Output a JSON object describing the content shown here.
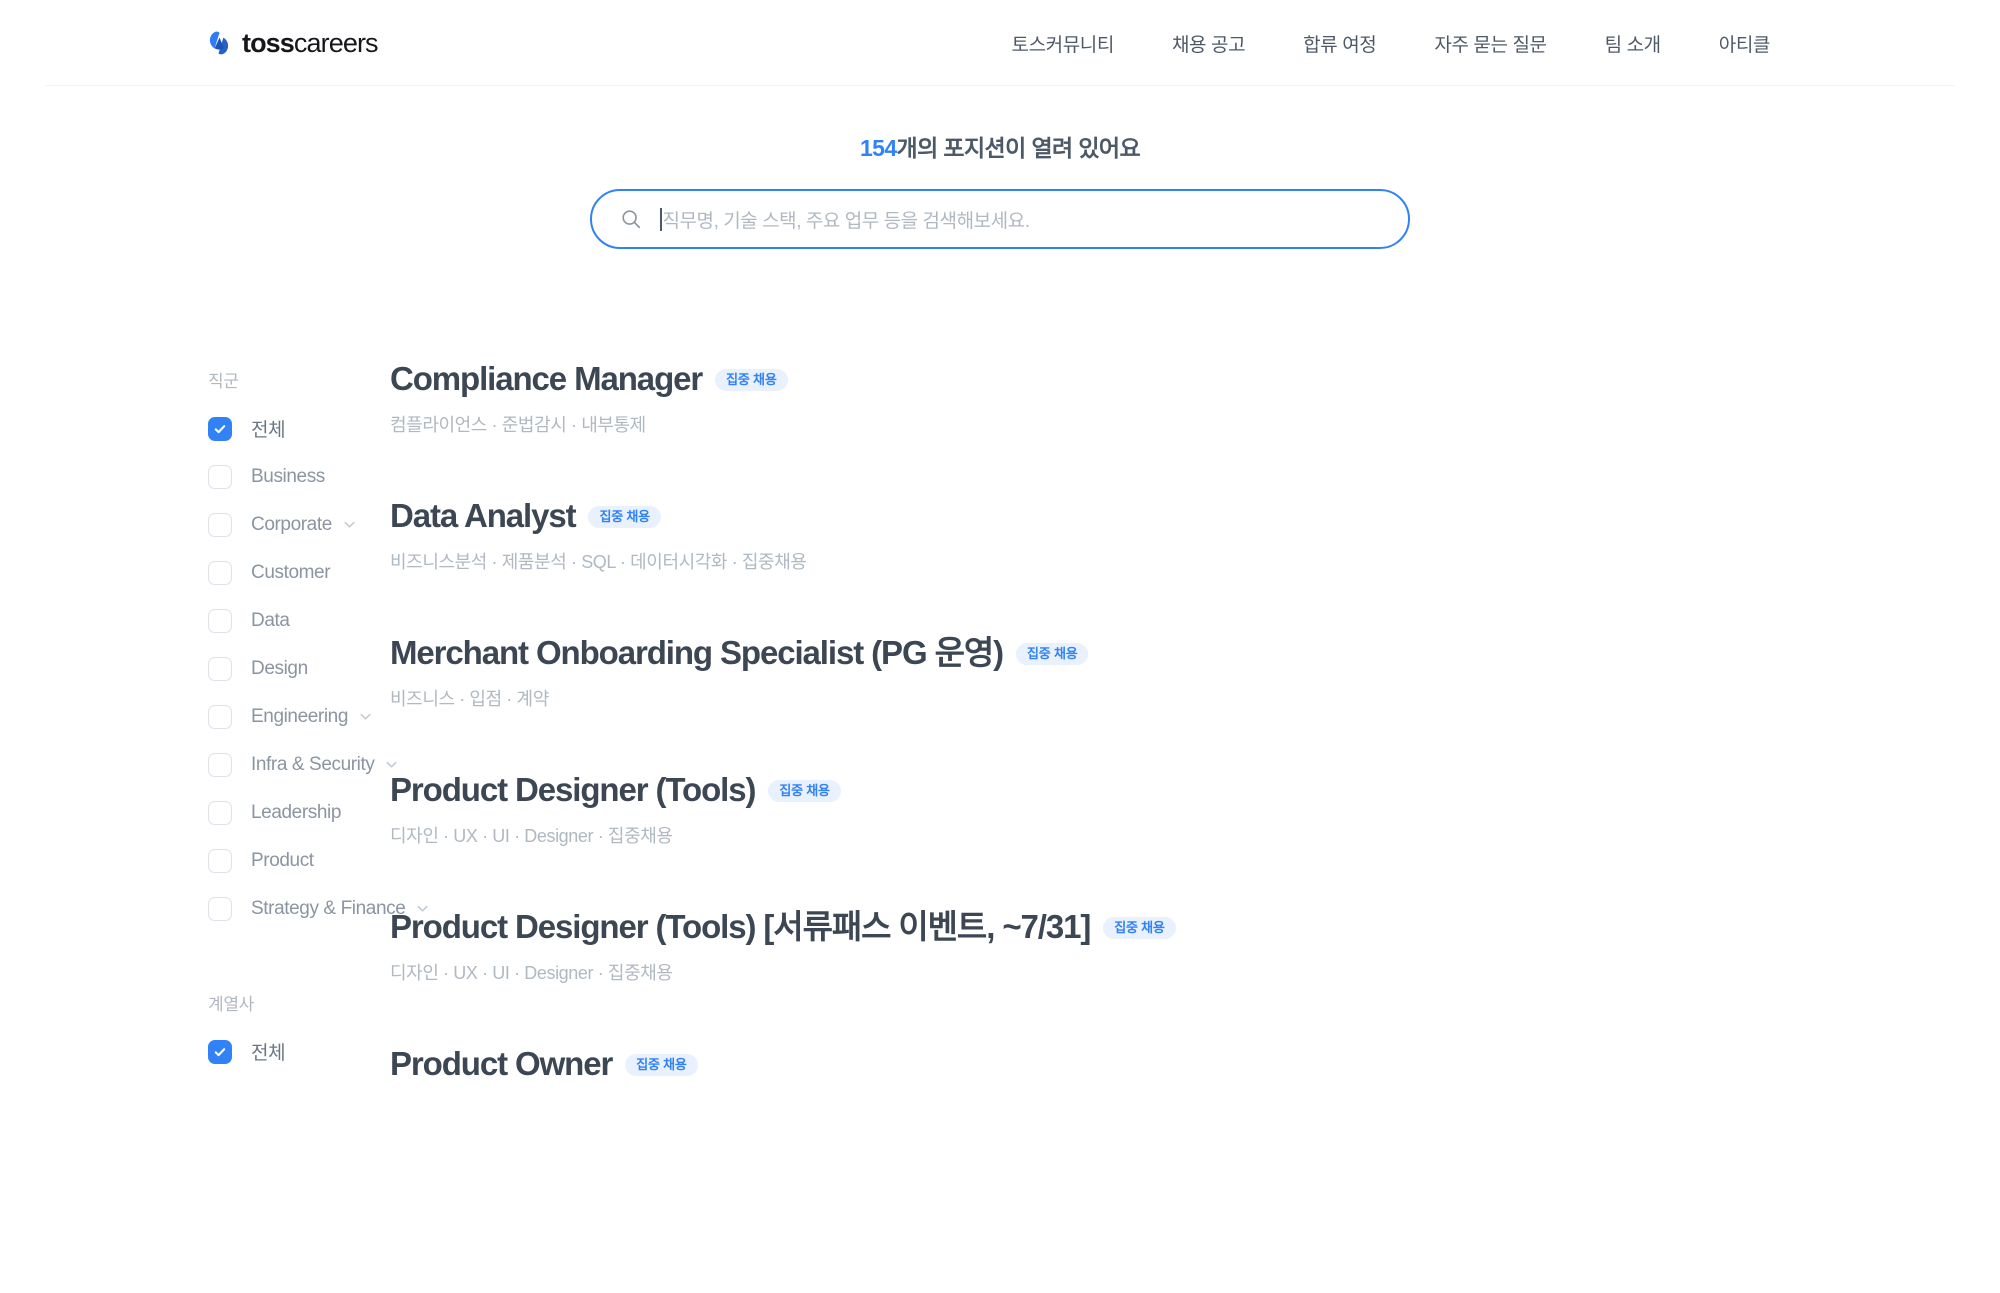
{
  "header": {
    "logo": {
      "icon": "toss-logo-icon",
      "bold": "toss",
      "light": "careers"
    },
    "nav": [
      {
        "label": "토스커뮤니티"
      },
      {
        "label": "채용 공고"
      },
      {
        "label": "합류 여정"
      },
      {
        "label": "자주 묻는 질문"
      },
      {
        "label": "팀 소개"
      },
      {
        "label": "아티클"
      }
    ]
  },
  "hero": {
    "count": "154",
    "count_suffix": "개의 포지션이 열려 있어요"
  },
  "search": {
    "icon": "search-icon",
    "placeholder": "직무명, 기술 스택, 주요 업무 등을 검색해보세요.",
    "value": ""
  },
  "filters": [
    {
      "title": "직군",
      "items": [
        {
          "label": "전체",
          "checked": true,
          "expandable": false
        },
        {
          "label": "Business",
          "checked": false,
          "expandable": false
        },
        {
          "label": "Corporate",
          "checked": false,
          "expandable": true
        },
        {
          "label": "Customer",
          "checked": false,
          "expandable": false
        },
        {
          "label": "Data",
          "checked": false,
          "expandable": false
        },
        {
          "label": "Design",
          "checked": false,
          "expandable": false
        },
        {
          "label": "Engineering",
          "checked": false,
          "expandable": true
        },
        {
          "label": "Infra & Security",
          "checked": false,
          "expandable": true
        },
        {
          "label": "Leadership",
          "checked": false,
          "expandable": false
        },
        {
          "label": "Product",
          "checked": false,
          "expandable": false
        },
        {
          "label": "Strategy & Finance",
          "checked": false,
          "expandable": true
        }
      ]
    },
    {
      "title": "계열사",
      "items": [
        {
          "label": "전체",
          "checked": true,
          "expandable": false
        }
      ]
    }
  ],
  "jobs": [
    {
      "title": "Compliance Manager",
      "badge": "집중 채용",
      "tags": "컴플라이언스 · 준법감시 · 내부통제"
    },
    {
      "title": "Data Analyst",
      "badge": "집중 채용",
      "tags": "비즈니스분석 · 제품분석 · SQL · 데이터시각화 · 집중채용"
    },
    {
      "title": "Merchant Onboarding Specialist (PG 운영)",
      "badge": "집중 채용",
      "tags": "비즈니스 · 입점 · 계약"
    },
    {
      "title": "Product Designer (Tools)",
      "badge": "집중 채용",
      "tags": "디자인 · UX · UI · Designer · 집중채용"
    },
    {
      "title": "Product Designer (Tools) [서류패스 이벤트, ~7/31]",
      "badge": "집중 채용",
      "tags": "디자인 · UX · UI · Designer · 집중채용"
    },
    {
      "title": "Product Owner",
      "badge": "집중 채용",
      "tags": ""
    }
  ],
  "colors": {
    "accent": "#3182f6",
    "badge_bg": "#e8f1fd",
    "title": "#3d4754",
    "muted": "#b0b8c1",
    "nav": "#4e5968"
  }
}
